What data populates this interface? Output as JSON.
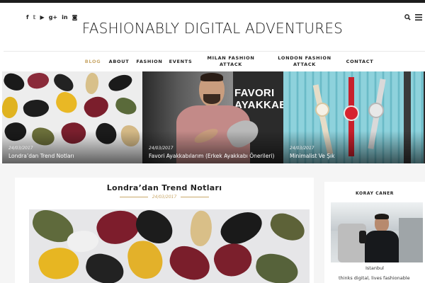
{
  "header": {
    "site_title": "FASHIONABLY DIGITAL ADVENTURES",
    "social_icons": [
      {
        "name": "facebook-icon",
        "glyph": "f"
      },
      {
        "name": "twitter-icon",
        "glyph": "𝕥"
      },
      {
        "name": "youtube-icon",
        "glyph": "▶"
      },
      {
        "name": "google-plus-icon",
        "glyph": "g+"
      },
      {
        "name": "linkedin-icon",
        "glyph": "in"
      },
      {
        "name": "instagram-icon",
        "glyph": "◙"
      }
    ],
    "right_icons": [
      {
        "name": "search-icon",
        "glyph": "🔍"
      },
      {
        "name": "menu-icon",
        "glyph": "≡"
      }
    ]
  },
  "nav": {
    "items": [
      {
        "label": "BLOG",
        "active": true
      },
      {
        "label": "ABOUT"
      },
      {
        "label": "FASHION"
      },
      {
        "label": "EVENTS"
      },
      {
        "label": "MILAN FASHION ATTACK"
      },
      {
        "label": "LONDON FASHION ATTACK"
      },
      {
        "label": "CONTACT"
      }
    ]
  },
  "slider": {
    "slides": [
      {
        "date": "24/03/2017",
        "title": "Londra’dan Trend Notları"
      },
      {
        "date": "24/03/2017",
        "title": "Favori Ayakkabılarım (Erkek Ayakkabı Önerileri)",
        "image_text": "FAVORI AYAKKABILAR"
      },
      {
        "date": "24/03/2017",
        "title": "Minimalist Ve Şık"
      }
    ]
  },
  "post": {
    "title": "Londra’dan Trend Notları",
    "date": "24/03/2017"
  },
  "sidebar": {
    "heading": "KORAY CANER",
    "caption": "Istanbul",
    "text": "thinks digital, lives fashionable"
  },
  "colors": {
    "accent": "#c9a86a",
    "topbar": "#1c1c1c",
    "background": "#f5f5f5"
  }
}
